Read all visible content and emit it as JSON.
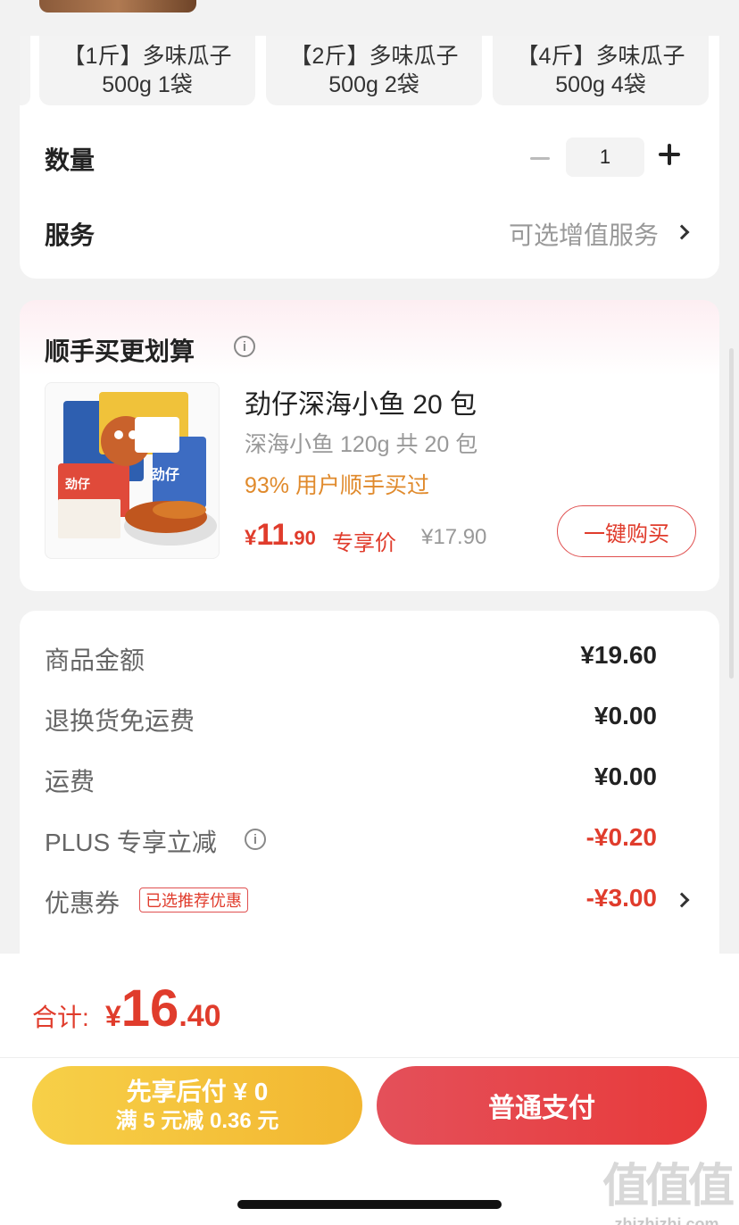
{
  "spec": {
    "options": [
      {
        "line1": "【1斤】多味瓜子",
        "line2": "500g 1袋"
      },
      {
        "line1": "【2斤】多味瓜子",
        "line2": "500g 2袋"
      },
      {
        "line1": "【4斤】多味瓜子",
        "line2": "500g 4袋"
      }
    ],
    "quantity_label": "数量",
    "quantity_value": "1",
    "service_label": "服务",
    "service_value": "可选增值服务"
  },
  "reco": {
    "title": "顺手买更划算",
    "product": {
      "name": "劲仔深海小鱼 20 包",
      "spec": "深海小鱼 120g 共 20 包",
      "buyers": "93% 用户顺手买过",
      "price_currency": "¥",
      "price_int": "11",
      "price_dec": ".90",
      "price_tag": "专享价",
      "original_price": "¥17.90",
      "buy_label": "一键购买",
      "image_brand_text": "劲仔"
    }
  },
  "fees": {
    "items": [
      {
        "label": "商品金额",
        "value": "¥19.60"
      },
      {
        "label": "退换货免运费",
        "value": "¥0.00"
      },
      {
        "label": "运费",
        "value": "¥0.00"
      },
      {
        "label": "PLUS 专享立减",
        "value": "-¥0.20"
      },
      {
        "label": "优惠券",
        "value": "-¥3.00"
      }
    ],
    "coupon_tag": "已选推荐优惠"
  },
  "bottom": {
    "total_label": "合计:",
    "total_currency": "¥",
    "total_int": "16",
    "total_dec": ".40",
    "pay_later_line1": "先享后付 ¥ 0",
    "pay_later_line2": "满 5 元减 0.36 元",
    "pay_normal": "普通支付"
  },
  "watermark": {
    "logo": "值值值",
    "url": "zhizhizhi.com"
  },
  "colors": {
    "accent_red": "#e03c2c",
    "accent_orange": "#e08a2c",
    "pay_later_yellow": "#f2b630"
  }
}
